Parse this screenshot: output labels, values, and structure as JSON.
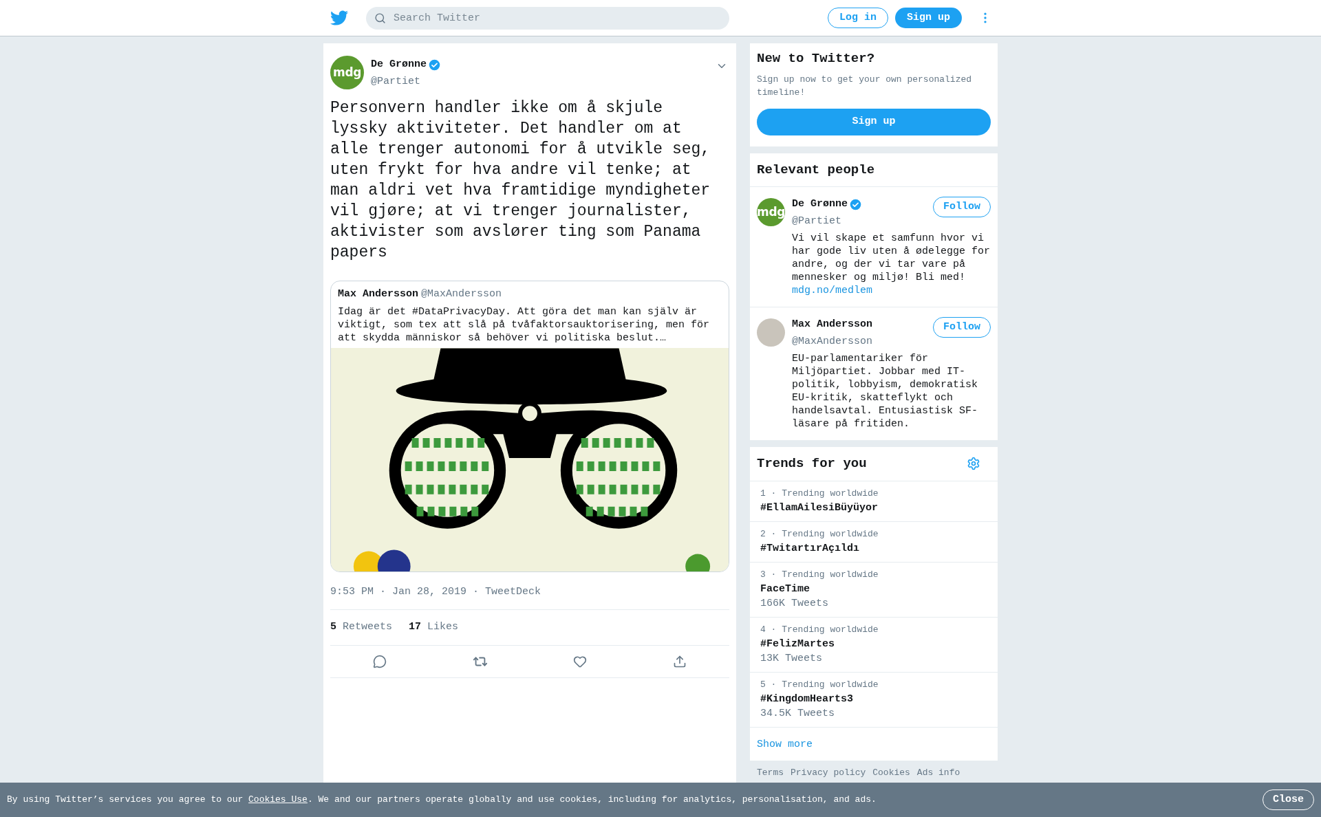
{
  "topbar": {
    "search_placeholder": "Search Twitter",
    "login": "Log in",
    "signup": "Sign up"
  },
  "tweet": {
    "author": {
      "name": "De Grønne",
      "handle": "@Partiet",
      "verified": true,
      "avatar_text": "mdg"
    },
    "text": "Personvern handler ikke om å skjule lyssky aktiviteter. Det handler om at alle trenger autonomi for å utvikle seg, uten frykt for hva andre vil tenke; at man aldri vet hva framtidige myndigheter vil gjøre; at vi trenger journalister, aktivister som avslører ting som Panama papers",
    "quote": {
      "name": "Max Andersson",
      "handle": "@MaxAndersson",
      "text": "Idag är det #DataPrivacyDay. Att göra det man kan själv är viktigt, som tex att slå på tvåfaktorsauktorisering, men för att skydda människor så behöver vi politiska beslut.…"
    },
    "meta": "9:53 PM · Jan 28, 2019 · TweetDeck",
    "stats": [
      {
        "count": "5",
        "label": "Retweets"
      },
      {
        "count": "17",
        "label": "Likes"
      }
    ]
  },
  "signup_card": {
    "title": "New to Twitter?",
    "text": "Sign up now to get your own personalized timeline!",
    "button": "Sign up"
  },
  "relevant_people": {
    "title": "Relevant people",
    "people": [
      {
        "name": "De Grønne",
        "handle": "@Partiet",
        "verified": true,
        "avatar": {
          "kind": "logo",
          "text": "mdg"
        },
        "bio": "Vi vil skape et samfunn hvor vi har gode liv uten å ødelegge for andre, og der vi tar vare på mennesker og miljø! Bli med!",
        "link": "mdg.no/medlem",
        "follow": "Follow"
      },
      {
        "name": "Max Andersson",
        "handle": "@MaxAndersson",
        "verified": false,
        "avatar": {
          "kind": "photo"
        },
        "bio": "EU-parlamentariker för Miljöpartiet. Jobbar med IT-politik, lobbyism, demokratisk EU-kritik, skatteflykt och handelsavtal. Entusiastisk SF-läsare på fritiden.",
        "follow": "Follow"
      }
    ]
  },
  "trends": {
    "title": "Trends for you",
    "items": [
      {
        "context": "1 · Trending worldwide",
        "name": "#EllamAilesiBüyüyor"
      },
      {
        "context": "2 · Trending worldwide",
        "name": "#TwitartırAçıldı"
      },
      {
        "context": "3 · Trending worldwide",
        "name": "FaceTime",
        "count": "166K Tweets"
      },
      {
        "context": "4 · Trending worldwide",
        "name": "#FelizMartes",
        "count": "13K Tweets"
      },
      {
        "context": "5 · Trending worldwide",
        "name": "#KingdomHearts3",
        "count": "34.5K Tweets"
      }
    ],
    "show_more": "Show more"
  },
  "footer_links": [
    "Terms",
    "Privacy policy",
    "Cookies",
    "Ads info"
  ],
  "cookie_bar": {
    "text_before": "By using Twitter’s services you agree to our ",
    "link": "Cookies Use",
    "text_after": ". We and our partners operate globally and use cookies, including for analytics, personalisation, and ads.",
    "close": "Close"
  }
}
